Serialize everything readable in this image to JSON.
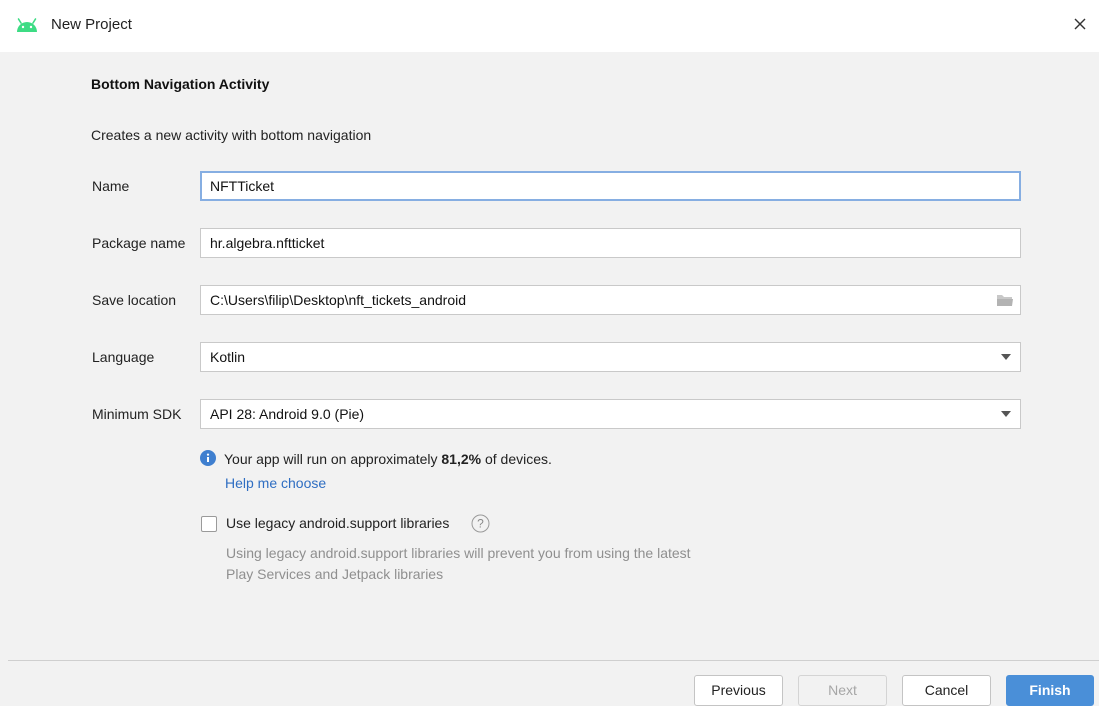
{
  "window": {
    "title": "New Project",
    "logo_icon": "android-icon",
    "close_icon": "close-icon"
  },
  "template": {
    "heading": "Bottom Navigation Activity",
    "description": "Creates a new activity with bottom navigation"
  },
  "form": {
    "name": {
      "label": "Name",
      "value": "NFTTicket"
    },
    "package_name": {
      "label": "Package name",
      "value": "hr.algebra.nftticket"
    },
    "save_location": {
      "label": "Save location",
      "value": "C:\\Users\\filip\\Desktop\\nft_tickets_android",
      "icon": "folder-icon"
    },
    "language": {
      "label": "Language",
      "value": "Kotlin"
    },
    "minimum_sdk": {
      "label": "Minimum SDK",
      "value": "API 28: Android 9.0 (Pie)"
    }
  },
  "info": {
    "icon": "info-icon",
    "text_before": "Your app will run on approximately ",
    "percentage": "81,2%",
    "text_after": " of devices.",
    "help_link": "Help me choose"
  },
  "legacy": {
    "checked": false,
    "label": "Use legacy android.support libraries",
    "help_icon": "question-icon",
    "hint": "Using legacy android.support libraries will prevent you from using the latest Play Services and Jetpack libraries"
  },
  "buttons": {
    "previous": "Previous",
    "next": "Next",
    "cancel": "Cancel",
    "finish": "Finish"
  },
  "colors": {
    "accent": "#4a8fd8",
    "link": "#2f6ec2",
    "android_green": "#3ddc84",
    "info_blue": "#3f7fcf"
  }
}
